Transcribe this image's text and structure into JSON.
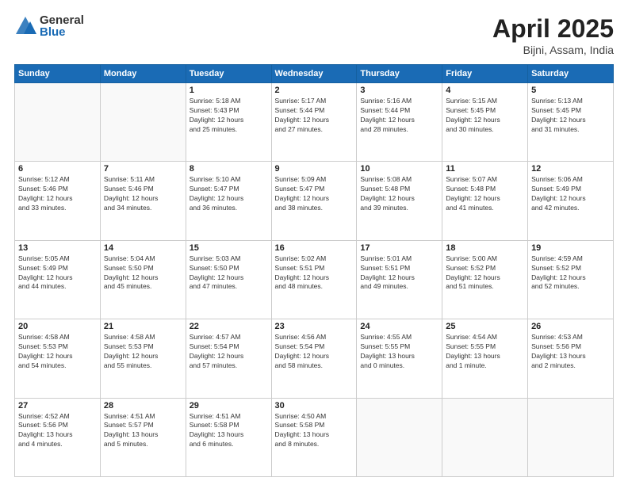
{
  "header": {
    "logo_general": "General",
    "logo_blue": "Blue",
    "title": "April 2025",
    "location": "Bijni, Assam, India"
  },
  "days_of_week": [
    "Sunday",
    "Monday",
    "Tuesday",
    "Wednesday",
    "Thursday",
    "Friday",
    "Saturday"
  ],
  "weeks": [
    [
      {
        "day": "",
        "info": ""
      },
      {
        "day": "",
        "info": ""
      },
      {
        "day": "1",
        "info": "Sunrise: 5:18 AM\nSunset: 5:43 PM\nDaylight: 12 hours\nand 25 minutes."
      },
      {
        "day": "2",
        "info": "Sunrise: 5:17 AM\nSunset: 5:44 PM\nDaylight: 12 hours\nand 27 minutes."
      },
      {
        "day": "3",
        "info": "Sunrise: 5:16 AM\nSunset: 5:44 PM\nDaylight: 12 hours\nand 28 minutes."
      },
      {
        "day": "4",
        "info": "Sunrise: 5:15 AM\nSunset: 5:45 PM\nDaylight: 12 hours\nand 30 minutes."
      },
      {
        "day": "5",
        "info": "Sunrise: 5:13 AM\nSunset: 5:45 PM\nDaylight: 12 hours\nand 31 minutes."
      }
    ],
    [
      {
        "day": "6",
        "info": "Sunrise: 5:12 AM\nSunset: 5:46 PM\nDaylight: 12 hours\nand 33 minutes."
      },
      {
        "day": "7",
        "info": "Sunrise: 5:11 AM\nSunset: 5:46 PM\nDaylight: 12 hours\nand 34 minutes."
      },
      {
        "day": "8",
        "info": "Sunrise: 5:10 AM\nSunset: 5:47 PM\nDaylight: 12 hours\nand 36 minutes."
      },
      {
        "day": "9",
        "info": "Sunrise: 5:09 AM\nSunset: 5:47 PM\nDaylight: 12 hours\nand 38 minutes."
      },
      {
        "day": "10",
        "info": "Sunrise: 5:08 AM\nSunset: 5:48 PM\nDaylight: 12 hours\nand 39 minutes."
      },
      {
        "day": "11",
        "info": "Sunrise: 5:07 AM\nSunset: 5:48 PM\nDaylight: 12 hours\nand 41 minutes."
      },
      {
        "day": "12",
        "info": "Sunrise: 5:06 AM\nSunset: 5:49 PM\nDaylight: 12 hours\nand 42 minutes."
      }
    ],
    [
      {
        "day": "13",
        "info": "Sunrise: 5:05 AM\nSunset: 5:49 PM\nDaylight: 12 hours\nand 44 minutes."
      },
      {
        "day": "14",
        "info": "Sunrise: 5:04 AM\nSunset: 5:50 PM\nDaylight: 12 hours\nand 45 minutes."
      },
      {
        "day": "15",
        "info": "Sunrise: 5:03 AM\nSunset: 5:50 PM\nDaylight: 12 hours\nand 47 minutes."
      },
      {
        "day": "16",
        "info": "Sunrise: 5:02 AM\nSunset: 5:51 PM\nDaylight: 12 hours\nand 48 minutes."
      },
      {
        "day": "17",
        "info": "Sunrise: 5:01 AM\nSunset: 5:51 PM\nDaylight: 12 hours\nand 49 minutes."
      },
      {
        "day": "18",
        "info": "Sunrise: 5:00 AM\nSunset: 5:52 PM\nDaylight: 12 hours\nand 51 minutes."
      },
      {
        "day": "19",
        "info": "Sunrise: 4:59 AM\nSunset: 5:52 PM\nDaylight: 12 hours\nand 52 minutes."
      }
    ],
    [
      {
        "day": "20",
        "info": "Sunrise: 4:58 AM\nSunset: 5:53 PM\nDaylight: 12 hours\nand 54 minutes."
      },
      {
        "day": "21",
        "info": "Sunrise: 4:58 AM\nSunset: 5:53 PM\nDaylight: 12 hours\nand 55 minutes."
      },
      {
        "day": "22",
        "info": "Sunrise: 4:57 AM\nSunset: 5:54 PM\nDaylight: 12 hours\nand 57 minutes."
      },
      {
        "day": "23",
        "info": "Sunrise: 4:56 AM\nSunset: 5:54 PM\nDaylight: 12 hours\nand 58 minutes."
      },
      {
        "day": "24",
        "info": "Sunrise: 4:55 AM\nSunset: 5:55 PM\nDaylight: 13 hours\nand 0 minutes."
      },
      {
        "day": "25",
        "info": "Sunrise: 4:54 AM\nSunset: 5:55 PM\nDaylight: 13 hours\nand 1 minute."
      },
      {
        "day": "26",
        "info": "Sunrise: 4:53 AM\nSunset: 5:56 PM\nDaylight: 13 hours\nand 2 minutes."
      }
    ],
    [
      {
        "day": "27",
        "info": "Sunrise: 4:52 AM\nSunset: 5:56 PM\nDaylight: 13 hours\nand 4 minutes."
      },
      {
        "day": "28",
        "info": "Sunrise: 4:51 AM\nSunset: 5:57 PM\nDaylight: 13 hours\nand 5 minutes."
      },
      {
        "day": "29",
        "info": "Sunrise: 4:51 AM\nSunset: 5:58 PM\nDaylight: 13 hours\nand 6 minutes."
      },
      {
        "day": "30",
        "info": "Sunrise: 4:50 AM\nSunset: 5:58 PM\nDaylight: 13 hours\nand 8 minutes."
      },
      {
        "day": "",
        "info": ""
      },
      {
        "day": "",
        "info": ""
      },
      {
        "day": "",
        "info": ""
      }
    ]
  ]
}
